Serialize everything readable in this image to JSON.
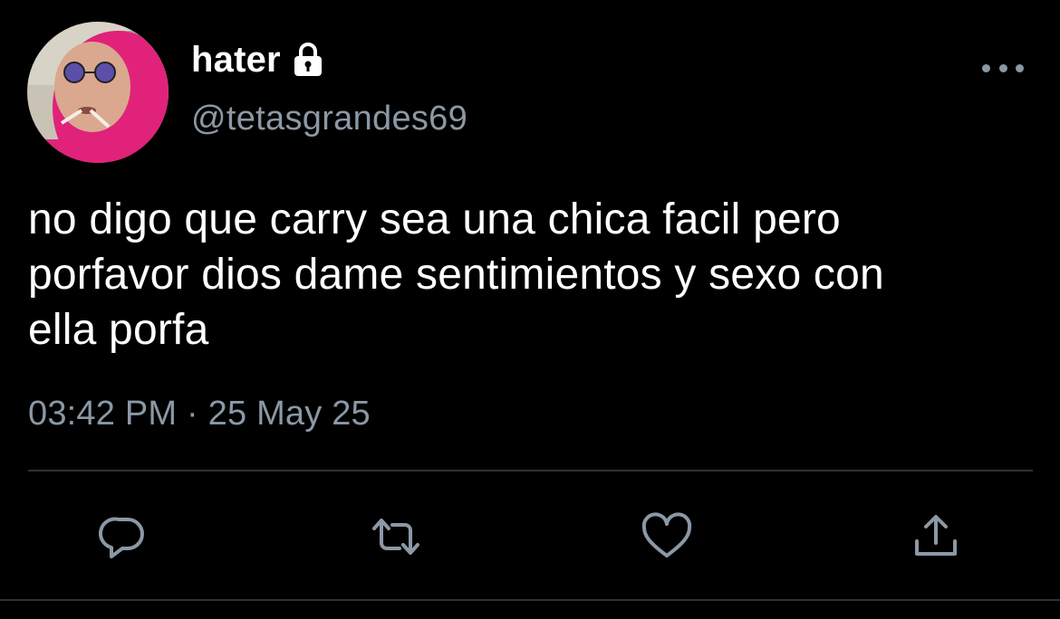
{
  "user": {
    "display_name": "hater",
    "handle": "@tetasgrandes69",
    "protected_icon": "lock-icon",
    "avatar_icon": "profile-avatar"
  },
  "tweet": {
    "text": "no digo que carry sea una chica facil pero\nporfavor dios dame sentimientos y sexo con\nella porfa",
    "time": "03:42 PM",
    "separator": "·",
    "date": "25 May 25"
  },
  "actions": [
    {
      "icon": "reply-icon"
    },
    {
      "icon": "retweet-icon"
    },
    {
      "icon": "like-icon"
    },
    {
      "icon": "share-icon"
    }
  ],
  "menu": {
    "icon": "more-options-icon"
  },
  "colors": {
    "background": "#000000",
    "primary_text": "#ffffff",
    "secondary_text": "#8b98a5",
    "divider": "#2f3336",
    "avatar_pink": "#e0227a"
  }
}
